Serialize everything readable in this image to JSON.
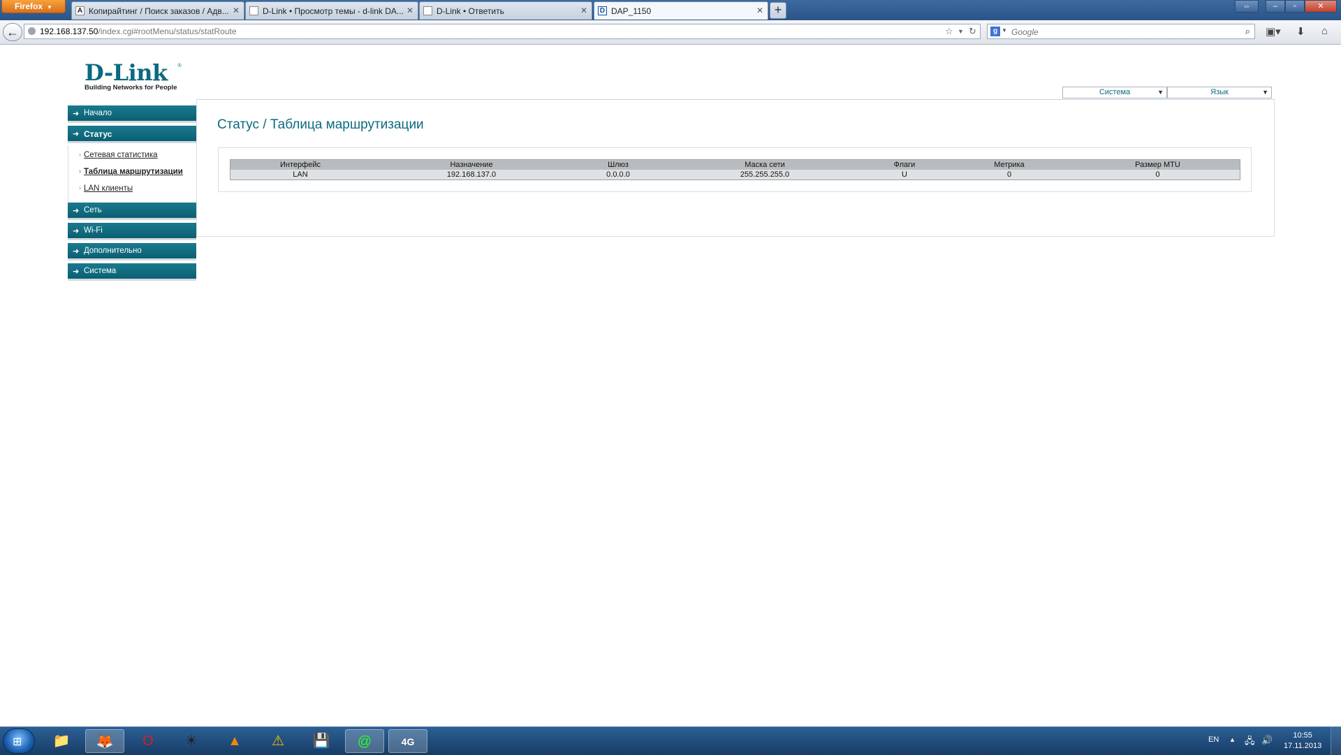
{
  "browser": {
    "menu_label": "Firefox",
    "tabs": [
      {
        "title": "Копирайтинг / Поиск заказов / Адв...",
        "favicon": "A"
      },
      {
        "title": "D-Link • Просмотр темы - d-link DA...",
        "favicon": ""
      },
      {
        "title": "D-Link • Ответить",
        "favicon": ""
      },
      {
        "title": "DAP_1150",
        "favicon": "D"
      }
    ],
    "url_host": "192.168.137.50",
    "url_path": "/index.cgi#rootMenu/status/statRoute",
    "search_placeholder": "Google"
  },
  "logo": {
    "brand": "D-Link",
    "tagline": "Building Networks for People",
    "reg": "®"
  },
  "top_selects": {
    "system": "Система",
    "language": "Язык"
  },
  "page": {
    "title": "Статус / Таблица маршрутизации",
    "table": {
      "headers": [
        "Интерфейс",
        "Назначение",
        "Шлюз",
        "Маска сети",
        "Флаги",
        "Метрика",
        "Размер MTU"
      ],
      "rows": [
        [
          "LAN",
          "192.168.137.0",
          "0.0.0.0",
          "255.255.255.0",
          "U",
          "0",
          "0"
        ]
      ]
    }
  },
  "sidebar": {
    "items": [
      {
        "label": "Начало"
      },
      {
        "label": "Статус"
      },
      {
        "label": "Сеть"
      },
      {
        "label": "Wi-Fi"
      },
      {
        "label": "Дополнительно"
      },
      {
        "label": "Система"
      }
    ],
    "sub_items": [
      {
        "label": "Сетевая статистика"
      },
      {
        "label": "Таблица маршрутизации"
      },
      {
        "label": "LAN клиенты"
      }
    ]
  },
  "taskbar": {
    "language": "EN",
    "time": "10:55",
    "date": "17.11.2013"
  }
}
